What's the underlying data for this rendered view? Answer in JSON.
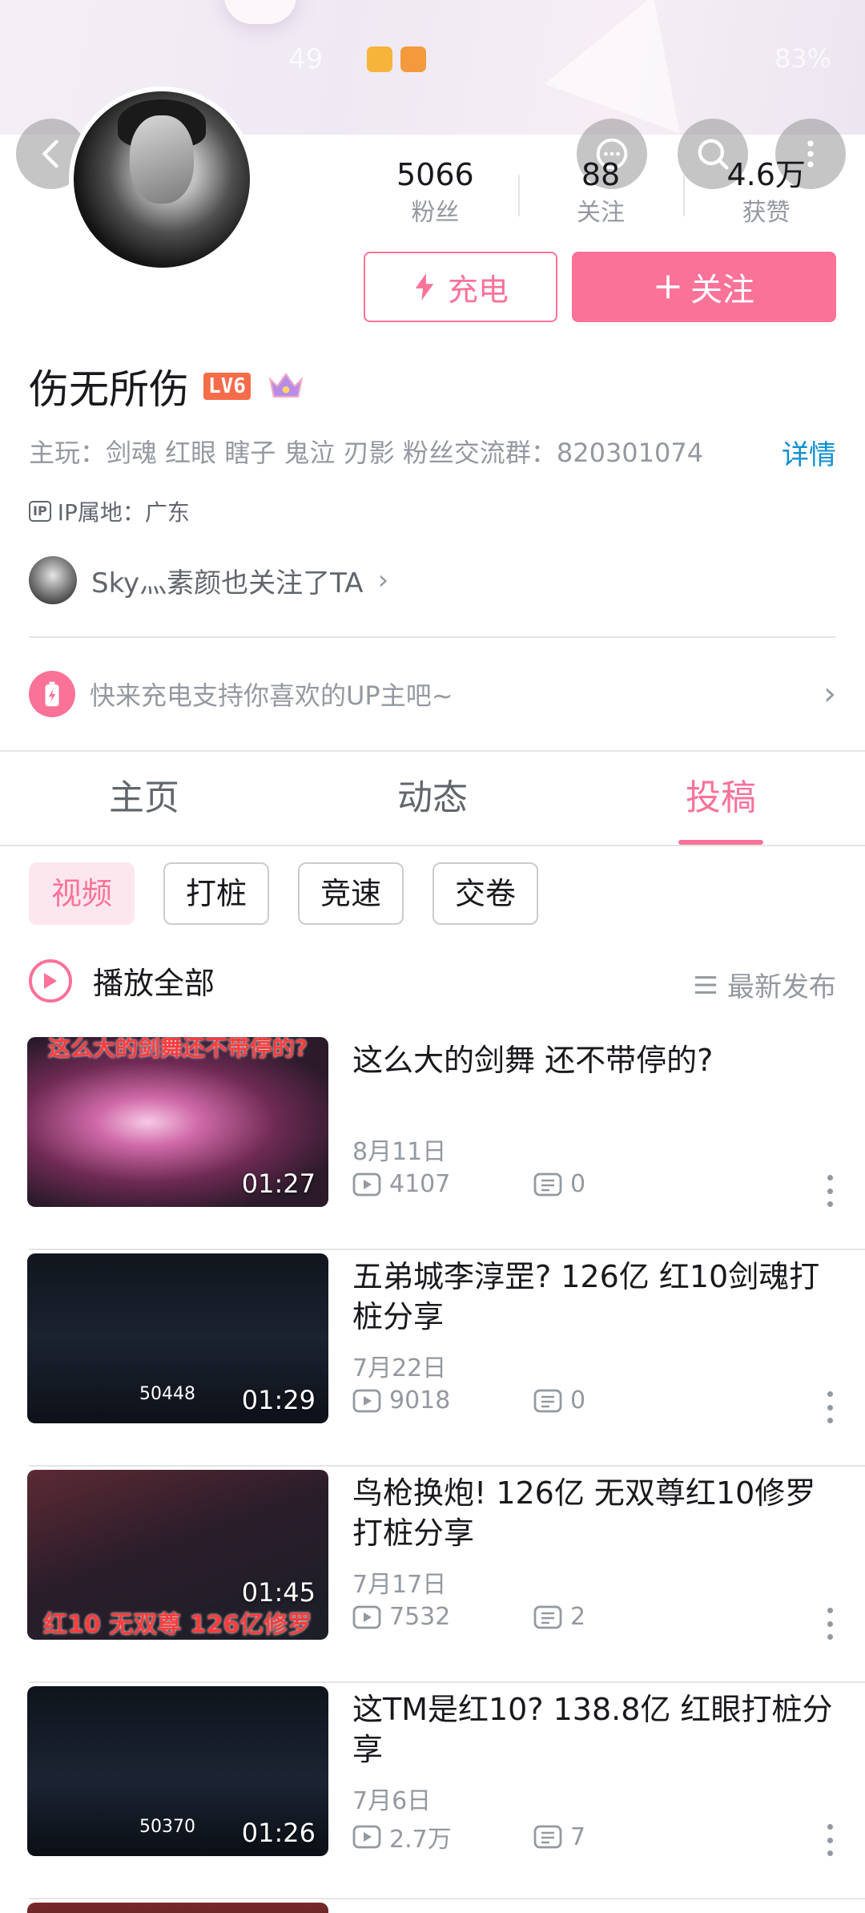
{
  "status_bar": {
    "time": "49",
    "battery": "83%"
  },
  "profile": {
    "name": "伤无所伤",
    "level": "LV6",
    "stats": [
      {
        "num": "5066",
        "label": "粉丝"
      },
      {
        "num": "88",
        "label": "关注"
      },
      {
        "num": "4.6万",
        "label": "获赞"
      }
    ],
    "charge_label": "充电",
    "follow_label": "关注",
    "bio": "主玩：剑魂 红眼 瞎子 鬼泣 刃影 粉丝交流群：820301074",
    "detail_label": "详情",
    "ip_icon": "IP",
    "ip_text": "IP属地：广东",
    "mutual_text": "Sky灬素颜也关注了TA",
    "charge_banner": "快来充电支持你喜欢的UP主吧~"
  },
  "tabs": [
    {
      "label": "主页",
      "active": false
    },
    {
      "label": "动态",
      "active": false
    },
    {
      "label": "投稿",
      "active": true
    }
  ],
  "chips": [
    {
      "label": "视频",
      "active": true
    },
    {
      "label": "打桩",
      "active": false
    },
    {
      "label": "竞速",
      "active": false
    },
    {
      "label": "交卷",
      "active": false
    }
  ],
  "play_all_label": "播放全部",
  "sort_label": "最新发布",
  "videos": [
    {
      "title": "这么大的剑舞 还不带停的?",
      "date": "8月11日",
      "plays": "4107",
      "comments": "0",
      "duration": "01:27",
      "overlay_top": "这么大的剑舞还不带停的?",
      "overlay_bottom": "",
      "score": ""
    },
    {
      "title": "五弟城李淳罡? 126亿 红10剑魂打桩分享",
      "date": "7月22日",
      "plays": "9018",
      "comments": "0",
      "duration": "01:29",
      "overlay_top": "",
      "overlay_bottom": "",
      "score": "50448"
    },
    {
      "title": "鸟枪换炮! 126亿 无双尊红10修罗 打桩分享",
      "date": "7月17日",
      "plays": "7532",
      "comments": "2",
      "duration": "01:45",
      "overlay_top": "",
      "overlay_bottom": "红10 无双尊 126亿修罗",
      "score": ""
    },
    {
      "title": "这TM是红10? 138.8亿 红眼打桩分享",
      "date": "7月6日",
      "plays": "2.7万",
      "comments": "7",
      "duration": "01:26",
      "overlay_top": "",
      "overlay_bottom": "",
      "score": "50370"
    }
  ]
}
